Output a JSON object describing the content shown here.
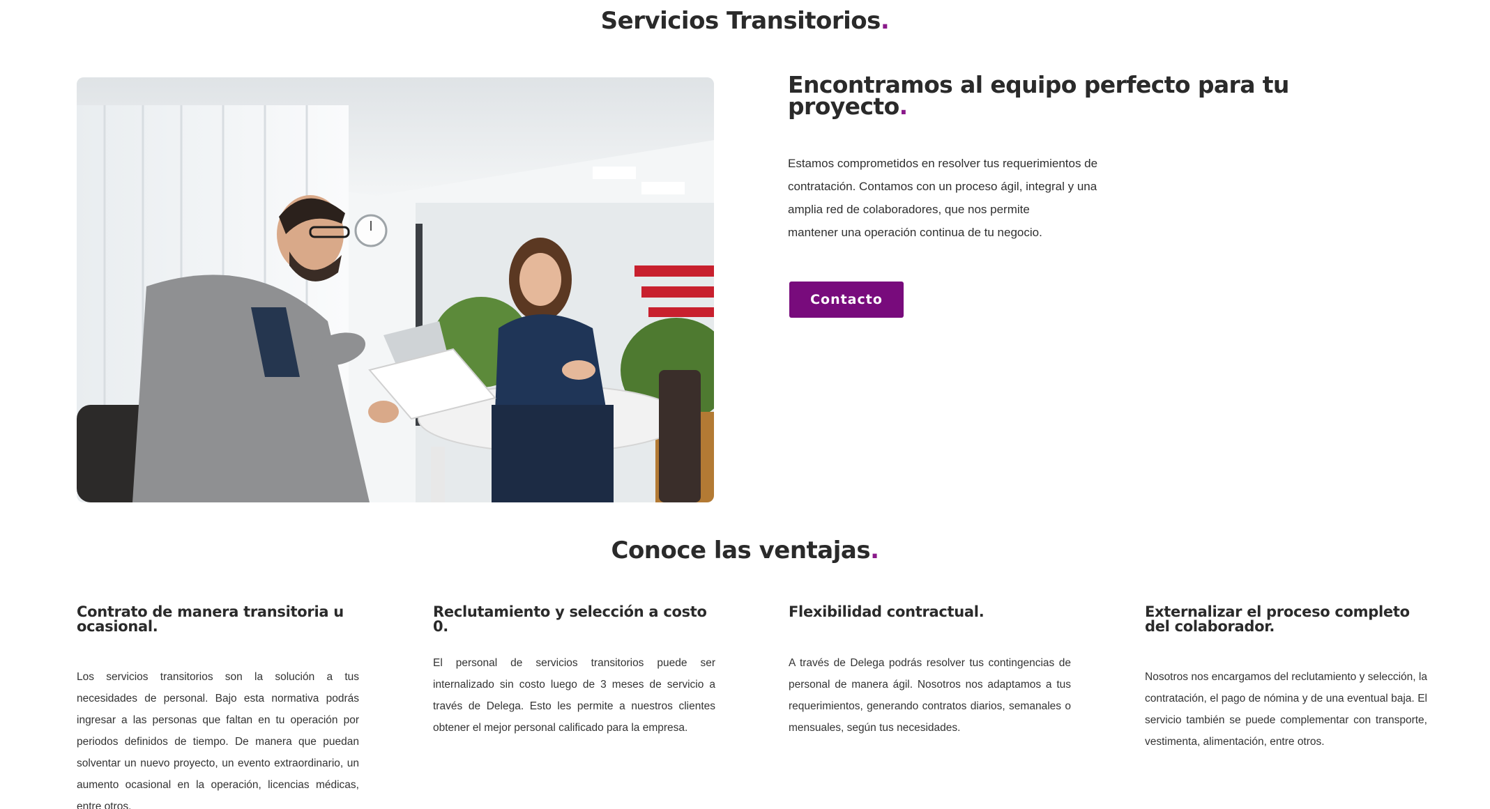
{
  "page": {
    "title": "Servicios Transitorios",
    "title_dot": ".",
    "accent_color": "#780b7c"
  },
  "hero": {
    "image_alt": "Entrevista de trabajo en oficina",
    "heading": "Encontramos al equipo perfecto para tu proyecto",
    "heading_dot": ".",
    "body_lines": [
      "Estamos comprometidos en resolver tus requerimientos de",
      "contratación. Contamos con un proceso ágil, integral y una",
      "amplia red de colaboradores, que nos permite",
      "mantener una operación continua de tu negocio."
    ],
    "button_label": "Contacto"
  },
  "benefits": {
    "title": "Conoce las ventajas",
    "title_dot": ".",
    "items": [
      {
        "title": "Contrato de manera transitoria u ocasional.",
        "text": "Los servicios transitorios son la solución a tus necesidades de personal. Bajo esta normativa podrás ingresar a las personas que faltan en tu operación por periodos definidos de tiempo. De manera que puedan solventar un nuevo proyecto, un evento extraordinario, un aumento ocasional en la operación, licencias médicas, entre otros."
      },
      {
        "title": "Reclutamiento y selección a costo 0.",
        "text": "El personal de servicios transitorios puede ser internalizado sin costo luego de 3 meses de servicio a través de Delega. Esto les permite a nuestros clientes obtener el mejor personal calificado para la empresa."
      },
      {
        "title": "Flexibilidad contractual.",
        "text": "A través de Delega podrás resolver tus contingencias de personal de manera ágil. Nosotros nos adaptamos a tus requerimientos, generando contratos diarios, semanales o mensuales, según tus necesidades."
      },
      {
        "title": "Externalizar el proceso completo del colaborador.",
        "text": "Nosotros nos encargamos del reclutamiento y selección, la contratación, el pago de nómina y de una eventual baja. El servicio también se puede complementar con transporte, vestimenta, alimentación, entre otros."
      }
    ]
  }
}
